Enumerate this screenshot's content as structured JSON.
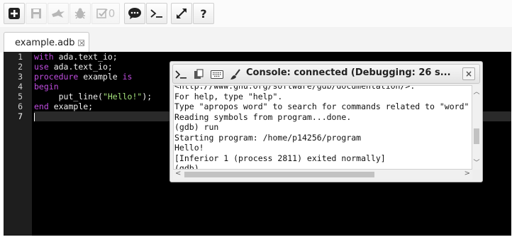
{
  "toolbar": {
    "buttons": [
      {
        "icon": "add-icon",
        "label": ""
      },
      {
        "icon": "save-icon",
        "label": ""
      },
      {
        "icon": "run-icon",
        "label": ""
      },
      {
        "icon": "debug-bug-icon",
        "label": ""
      },
      {
        "icon": "check-icon",
        "label": "0"
      },
      {
        "icon": "chat-icon",
        "label": ""
      },
      {
        "icon": "terminal-icon",
        "label": ""
      },
      {
        "icon": "expand-icon",
        "label": ""
      },
      {
        "icon": "help-icon",
        "label": "?"
      }
    ]
  },
  "tabs": [
    {
      "label": "example.adb",
      "close": "×"
    }
  ],
  "editor": {
    "line_numbers": [
      "1",
      "2",
      "3",
      "4",
      "5",
      "6",
      "7"
    ],
    "active_line": 7,
    "lines": [
      {
        "kw": "with",
        "rest": " ada.text_io;"
      },
      {
        "kw": "use",
        "rest": " ada.text_io;"
      },
      {
        "kw": "procedure",
        "rest": " example ",
        "kw2": "is"
      },
      {
        "kw": "begin",
        "rest": ""
      },
      {
        "pre": "     put_line(",
        "str": "\"Hello!\"",
        "post": ");"
      },
      {
        "kw": "end",
        "rest": " example;"
      },
      {
        "kw": "",
        "rest": ""
      }
    ]
  },
  "console": {
    "title": "Console: connected (Debugging: 26 s...",
    "close": "×",
    "lines": [
      "<http://www.gnu.org/software/gdb/documentation/>.",
      "For help, type \"help\".",
      "Type \"apropos word\" to search for commands related to \"word\"",
      "Reading symbols from program...done.",
      "(gdb) run",
      "Starting program: /home/p14256/program",
      "Hello!",
      "[Inferior 1 (process 2811) exited normally]",
      "(gdb)"
    ]
  },
  "colors": {
    "keyword": "#c04de0",
    "string": "#a3e07a",
    "editor_bg": "#000000",
    "gutter_bg": "#1e1e1e"
  }
}
